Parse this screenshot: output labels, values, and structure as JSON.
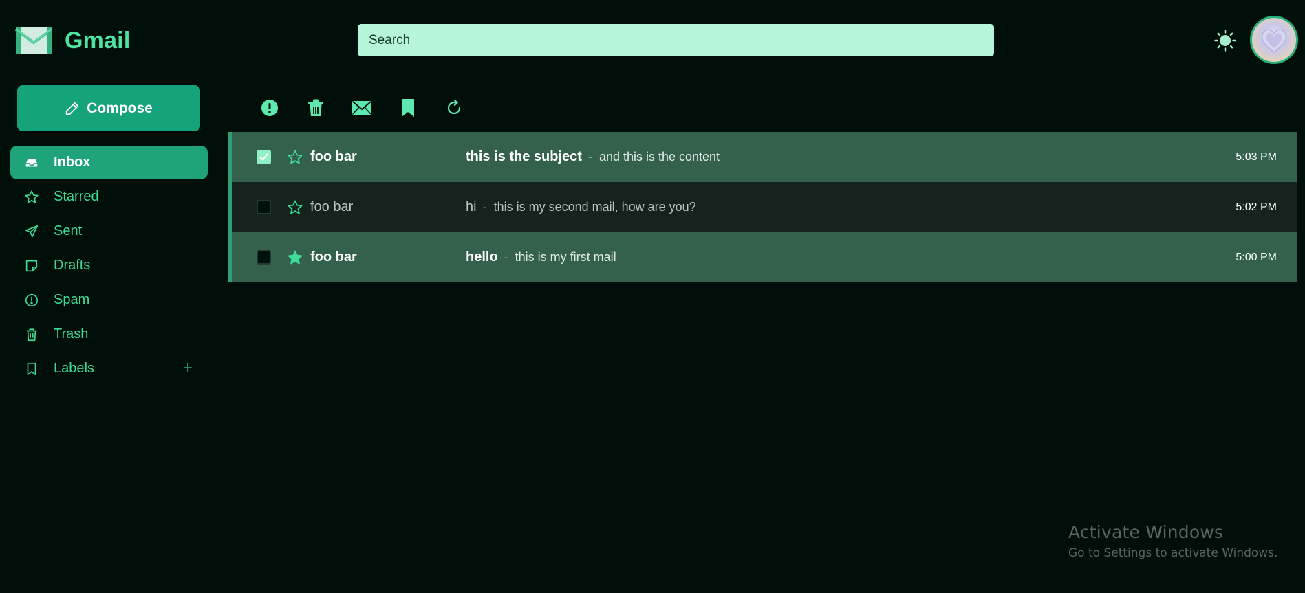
{
  "app": {
    "name": "Gmail"
  },
  "search": {
    "placeholder": "Search"
  },
  "sidebar": {
    "compose_label": "Compose",
    "items": [
      {
        "label": "Inbox",
        "icon": "inbox-icon",
        "active": true
      },
      {
        "label": "Starred",
        "icon": "star-icon",
        "active": false
      },
      {
        "label": "Sent",
        "icon": "send-icon",
        "active": false
      },
      {
        "label": "Drafts",
        "icon": "draft-icon",
        "active": false
      },
      {
        "label": "Spam",
        "icon": "spam-icon",
        "active": false
      },
      {
        "label": "Trash",
        "icon": "trash-icon",
        "active": false
      },
      {
        "label": "Labels",
        "icon": "label-icon",
        "active": false,
        "add": "+"
      }
    ]
  },
  "toolbar": {
    "actions": [
      "report-spam-icon",
      "delete-icon",
      "mark-unread-icon",
      "label-icon",
      "refresh-icon"
    ]
  },
  "emails": [
    {
      "sender": "foo bar",
      "subject": "this is the subject",
      "separator": "-",
      "preview": "and this is the content",
      "time": "5:03 PM",
      "checked": true,
      "starred": false,
      "unread": true
    },
    {
      "sender": "foo bar",
      "subject": "hi",
      "separator": "-",
      "preview": "this is my second mail, how are you?",
      "time": "5:02 PM",
      "checked": false,
      "starred": false,
      "unread": false
    },
    {
      "sender": "foo bar",
      "subject": "hello",
      "separator": "-",
      "preview": "this is my first mail",
      "time": "5:00 PM",
      "checked": false,
      "starred": true,
      "unread": true
    }
  ],
  "watermark": {
    "title": "Activate Windows",
    "subtitle": "Go to Settings to activate Windows."
  },
  "colors": {
    "accent": "#3ddc97",
    "background": "#000f0a",
    "active": "#1fa37a",
    "search_bg": "#b7f5da",
    "row_unread": "#33614c",
    "row_read": "#14231d"
  }
}
